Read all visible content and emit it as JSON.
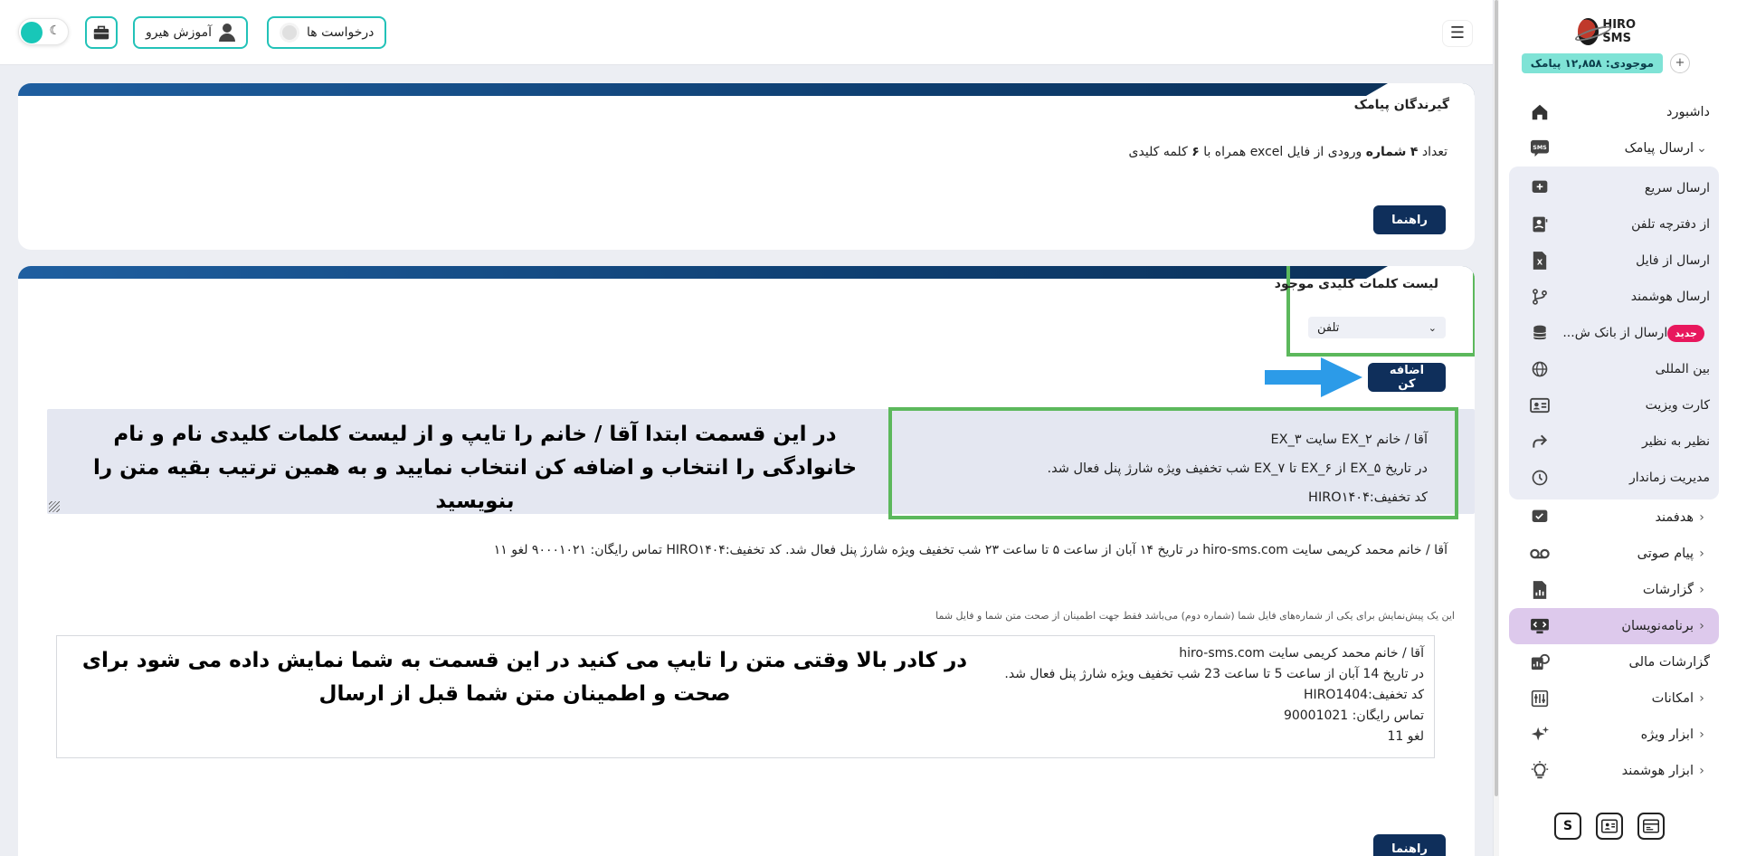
{
  "sidebar": {
    "logo_text": "HIRO SMS",
    "balance": "موجودی: ۱۲,۸۵۸ پیامک",
    "items": [
      {
        "label": "داشبورد",
        "icon": "home-icon"
      },
      {
        "label": "ارسال پیامک",
        "icon": "sms-icon"
      },
      {
        "label": "ارسال سریع",
        "icon": "plus-chat-icon"
      },
      {
        "label": "از دفترچه تلفن",
        "icon": "contacts-icon"
      },
      {
        "label": "ارسال از فایل",
        "icon": "excel-file-icon"
      },
      {
        "label": "ارسال هوشمند",
        "icon": "branch-icon"
      },
      {
        "label": "ارسال از بانک ش...",
        "icon": "database-icon",
        "badge": "جدید"
      },
      {
        "label": "بین المللی",
        "icon": "globe-icon"
      },
      {
        "label": "کارت ویزیت",
        "icon": "business-card-icon"
      },
      {
        "label": "نظیر به نظیر",
        "icon": "share-arrow-icon"
      },
      {
        "label": "مدیریت زماندار",
        "icon": "clock-icon"
      },
      {
        "label": "هدفمند",
        "icon": "target-chat-icon"
      },
      {
        "label": "پیام صوتی",
        "icon": "voicemail-icon"
      },
      {
        "label": "گزارشات",
        "icon": "report-icon"
      },
      {
        "label": "برنامه‌نویسان",
        "icon": "code-icon"
      },
      {
        "label": "گزارشات مالی",
        "icon": "finance-icon"
      },
      {
        "label": "امکانات",
        "icon": "features-icon"
      },
      {
        "label": "ابزار ویژه",
        "icon": "sparkle-icon"
      },
      {
        "label": "ابزار هوشمند",
        "icon": "bulb-icon"
      }
    ],
    "bottom_buttons": [
      "S"
    ]
  },
  "topbar": {
    "requests_label": "درخواست ها",
    "training_label": "آموزش هیرو"
  },
  "card1": {
    "title": "گیرندگان پیامک",
    "info_pre": "تعداد",
    "info_count": "۴",
    "info_word": "شماره",
    "info_mid": "ورودی از فایل excel همراه با",
    "info_keywords": "۶",
    "info_post": "کلمه کلیدی",
    "help_button": "راهنما"
  },
  "card2": {
    "title": "لیست کلمات کلیدی موجود",
    "select_value": "تلفن",
    "add_button": "اضافه کن",
    "editor_lines": [
      "آقا / خانم  EX_۲ سایت EX_۳",
      "در تاریخ EX_۵ از EX_۶ تا EX_۷ شب تخفیف ویژه شارژ پنل فعال شد.",
      "کد تخفیف:HIRO۱۴۰۴"
    ],
    "annotation_editor": "در این قسمت ابتدا آقا / خانم را تایپ و از لیست کلمات کلیدی نام و نام خانوادگی را انتخاب و اضافه کن انتخاب نمایید و به همین ترتیب بقیه متن را بنویسید",
    "preview_line": "آقا / خانم محمد کریمی سایت hiro-sms.com در تاریخ ۱۴ آبان از ساعت ۵ تا ساعت ۲۳ شب تخفیف ویژه شارژ پنل فعال شد. کد تخفیف:HIRO۱۴۰۴ تماس رایگان: ۹۰۰۰۱۰۲۱ لغو ۱۱",
    "preview_note": "این یک پیش‌نمایش برای یکی از شماره‌های فایل شما (شماره دوم) می‌باشد فقط جهت اطمینان از صحت متن شما و فایل شما",
    "preview_box_lines": [
      "آقا / خانم  محمد کریمی سایت hiro-sms.com",
      "در تاریخ 14 آبان  از ساعت 5 تا ساعت 23 شب تخفیف ویژه شارژ پنل فعال شد.",
      "کد تخفیف:HIRO1404",
      "تماس رایگان: 90001021",
      "لغو 11"
    ],
    "annotation_preview": "در کادر بالا وقتی متن را تایپ می کنید در این قسمت به شما نمایش داده می شود برای صحت و اطمینان متن شما قبل از ارسال",
    "help_button": "راهنما"
  },
  "colors": {
    "accent_teal": "#22c2b8",
    "primary_navy": "#0f2f5b",
    "highlight_green": "#5cb85c",
    "arrow_blue": "#2c9be8",
    "badge_pink": "#e8175d",
    "active_lilac": "#ddc9ec"
  }
}
